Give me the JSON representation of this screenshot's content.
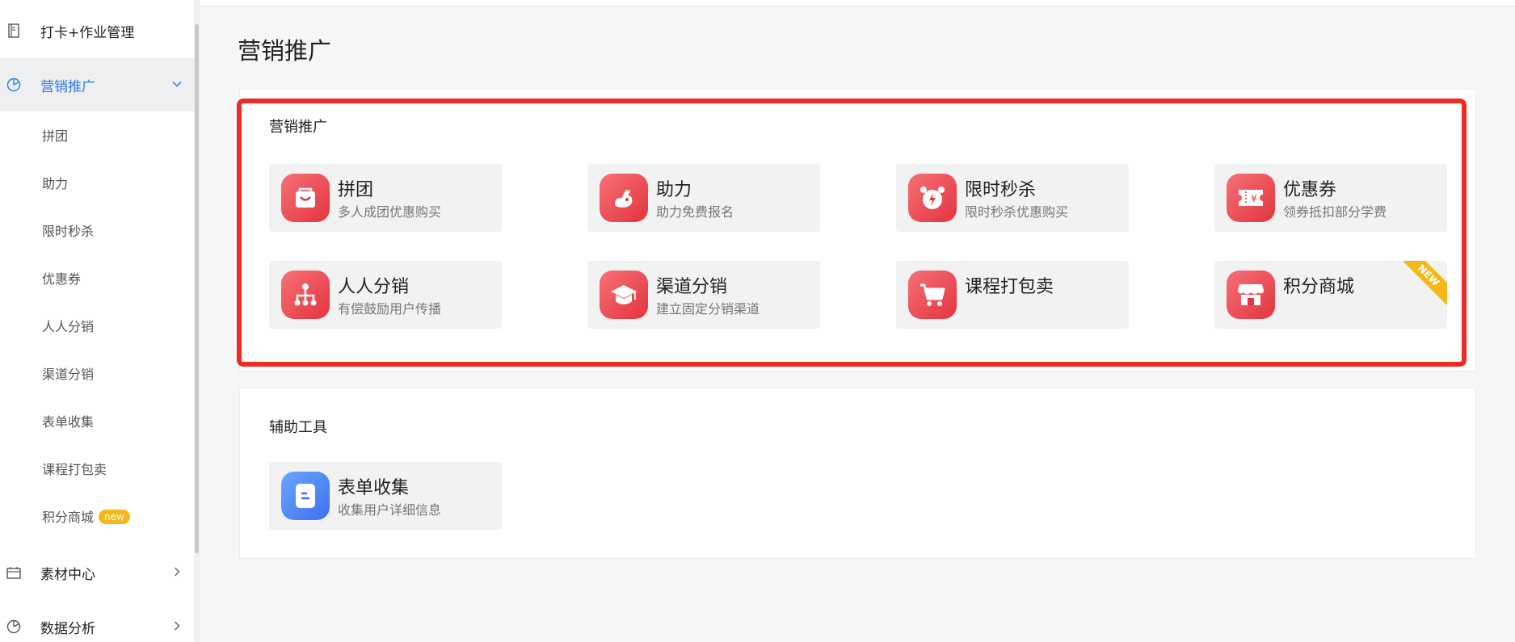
{
  "sidebar": {
    "items": [
      {
        "label": "打卡+作业管理",
        "icon": "notebook-icon"
      },
      {
        "label": "营销推广",
        "icon": "pie-chart-icon",
        "expanded": true
      },
      {
        "label": "素材中心",
        "icon": "calendar-icon"
      },
      {
        "label": "数据分析",
        "icon": "pie-chart-icon"
      }
    ],
    "sub_items": [
      "拼团",
      "助力",
      "限时秒杀",
      "优惠券",
      "人人分销",
      "渠道分销",
      "表单收集",
      "课程打包卖",
      "积分商城"
    ],
    "new_badge": "new"
  },
  "page": {
    "title": "营销推广"
  },
  "marketing": {
    "title": "营销推广",
    "cards": [
      {
        "title": "拼团",
        "desc": "多人成团优惠购买",
        "icon": "shopping-bag-icon"
      },
      {
        "title": "助力",
        "desc": "助力免费报名",
        "icon": "flexed-arm-icon"
      },
      {
        "title": "限时秒杀",
        "desc": "限时秒杀优惠购买",
        "icon": "alarm-clock-icon"
      },
      {
        "title": "优惠券",
        "desc": "领券抵扣部分学费",
        "icon": "coupon-icon"
      },
      {
        "title": "人人分销",
        "desc": "有偿鼓励用户传播",
        "icon": "org-chart-icon"
      },
      {
        "title": "渠道分销",
        "desc": "建立固定分销渠道",
        "icon": "graduation-cap-icon"
      },
      {
        "title": "课程打包卖",
        "desc": "",
        "icon": "shopping-cart-icon"
      },
      {
        "title": "积分商城",
        "desc": "",
        "icon": "store-icon",
        "corner": "NEW"
      }
    ]
  },
  "tools": {
    "title": "辅助工具",
    "cards": [
      {
        "title": "表单收集",
        "desc": "收集用户详细信息",
        "icon": "form-icon"
      }
    ]
  },
  "colors": {
    "accent": "#2f7be5",
    "card_icon_red": "#e3343f",
    "highlight_border": "#ef2a24",
    "badge_yellow": "#f5b81a"
  }
}
